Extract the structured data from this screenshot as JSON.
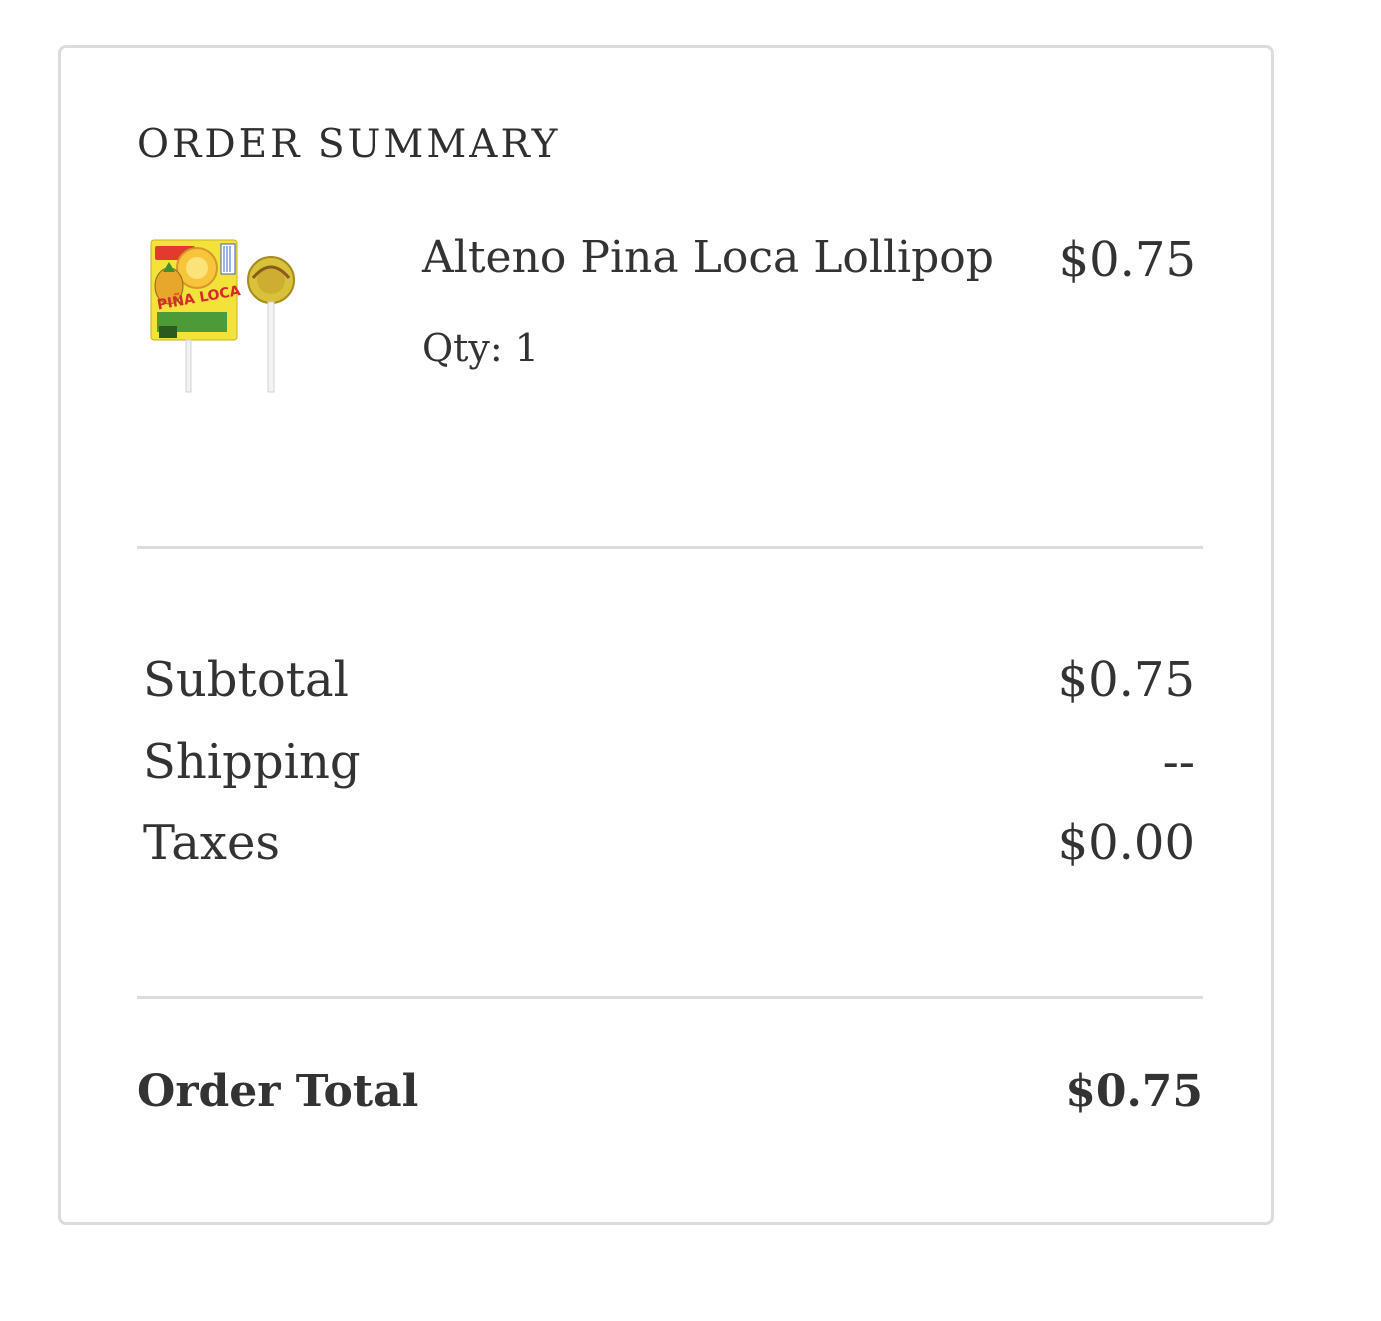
{
  "order_summary": {
    "title": "ORDER SUMMARY",
    "item": {
      "name": "Alteno Pina Loca Lollipop",
      "qty_label": "Qty: 1",
      "price": "$0.75",
      "image": "product-image-pina-loca-lollipop",
      "image_text": "PIÑA LOCA"
    },
    "totals": {
      "subtotal_label": "Subtotal",
      "subtotal_value": "$0.75",
      "shipping_label": "Shipping",
      "shipping_value": "--",
      "taxes_label": "Taxes",
      "taxes_value": "$0.00"
    },
    "order_total": {
      "label": "Order Total",
      "value": "$0.75"
    }
  },
  "colors": {
    "border": "#dcdcdc",
    "text": "#333333",
    "background": "#ffffff"
  }
}
